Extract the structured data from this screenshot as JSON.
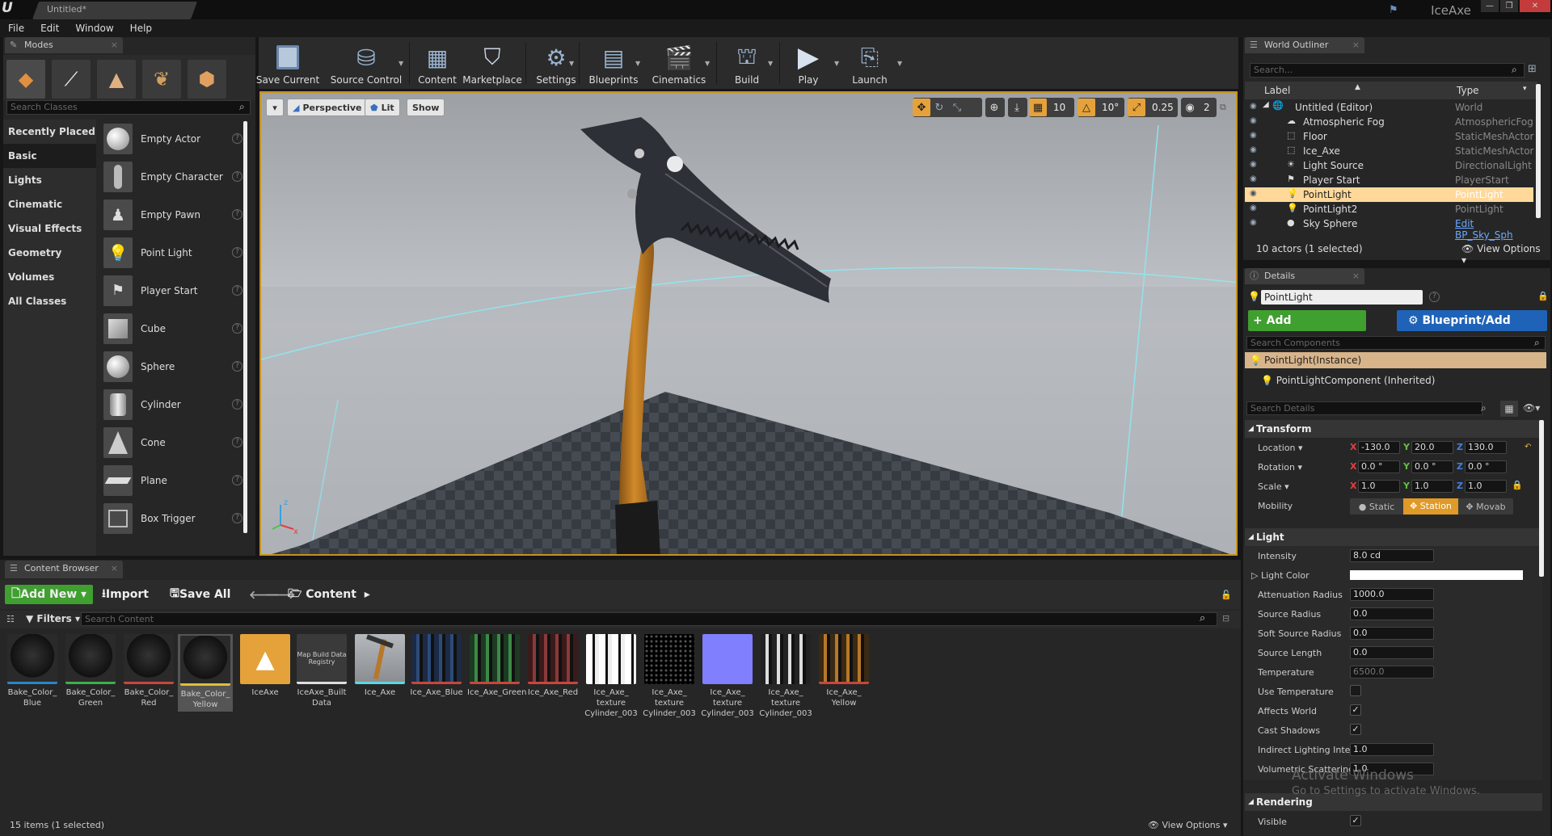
{
  "app": {
    "document_tab": "Untitled*",
    "project_name": "IceAxe"
  },
  "menu": [
    "File",
    "Edit",
    "Window",
    "Help"
  ],
  "modes": {
    "tab": "Modes",
    "search_placeholder": "Search Classes",
    "categories": [
      "Recently Placed",
      "Basic",
      "Lights",
      "Cinematic",
      "Visual Effects",
      "Geometry",
      "Volumes",
      "All Classes"
    ],
    "active_category": "Basic",
    "items": [
      "Empty Actor",
      "Empty Character",
      "Empty Pawn",
      "Point Light",
      "Player Start",
      "Cube",
      "Sphere",
      "Cylinder",
      "Cone",
      "Plane",
      "Box Trigger"
    ]
  },
  "toolbar": [
    "Save Current",
    "Source Control",
    "Content",
    "Marketplace",
    "Settings",
    "Blueprints",
    "Cinematics",
    "Build",
    "Play",
    "Launch"
  ],
  "viewport": {
    "perspective": "Perspective",
    "lit": "Lit",
    "show": "Show",
    "grid_snap": "10",
    "rot_snap": "10°",
    "scale_snap": "0.25",
    "camera_speed": "2"
  },
  "outliner": {
    "tab": "World Outliner",
    "search_placeholder": "Search...",
    "col_label": "Label",
    "col_type": "Type",
    "rows": [
      {
        "label": "Untitled (Editor)",
        "type": "World"
      },
      {
        "label": "Atmospheric Fog",
        "type": "AtmosphericFog"
      },
      {
        "label": "Floor",
        "type": "StaticMeshActor"
      },
      {
        "label": "Ice_Axe",
        "type": "StaticMeshActor"
      },
      {
        "label": "Light Source",
        "type": "DirectionalLight"
      },
      {
        "label": "Player Start",
        "type": "PlayerStart"
      },
      {
        "label": "PointLight",
        "type": "PointLight"
      },
      {
        "label": "PointLight2",
        "type": "PointLight"
      },
      {
        "label": "Sky Sphere",
        "type": "Edit BP_Sky_Sph"
      }
    ],
    "footer": "10 actors (1 selected)",
    "view_options": "View Options"
  },
  "details": {
    "tab": "Details",
    "name": "PointLight",
    "add_component": "+ Add Component",
    "blueprint": "Blueprint/Add Script",
    "search_components": "Search Components",
    "instance": "PointLight(Instance)",
    "component": "PointLightComponent (Inherited)",
    "search_details": "Search Details",
    "transform": "Transform",
    "location_label": "Location",
    "rotation_label": "Rotation",
    "scale_label": "Scale",
    "mobility_label": "Mobility",
    "location": [
      "-130.0",
      "20.0",
      "130.0"
    ],
    "rotation": [
      "0.0 °",
      "0.0 °",
      "0.0 °"
    ],
    "scale": [
      "1.0",
      "1.0",
      "1.0"
    ],
    "mobility": [
      "Static",
      "Station",
      "Movab"
    ],
    "light": "Light",
    "intensity_label": "Intensity",
    "intensity": "8.0 cd",
    "light_color_label": "Light Color",
    "atten_label": "Attenuation Radius",
    "atten": "1000.0",
    "source_radius_label": "Source Radius",
    "source_radius": "0.0",
    "soft_radius_label": "Soft Source Radius",
    "soft_radius": "0.0",
    "source_length_label": "Source Length",
    "source_length": "0.0",
    "temperature_label": "Temperature",
    "temperature": "6500.0",
    "use_temp_label": "Use Temperature",
    "affects_world_label": "Affects World",
    "cast_shadows_label": "Cast Shadows",
    "indirect_label": "Indirect Lighting Inten:",
    "indirect": "1.0",
    "volumetric_label": "Volumetric Scattering",
    "volumetric": "1.0",
    "rendering": "Rendering",
    "visible_label": "Visible"
  },
  "content_browser": {
    "tab": "Content Browser",
    "add_new": "Add New",
    "import": "Import",
    "save_all": "Save All",
    "path": "Content",
    "filters": "Filters",
    "search_placeholder": "Search Content",
    "assets": [
      "Bake_Color_ Blue",
      "Bake_Color_ Green",
      "Bake_Color_ Red",
      "Bake_Color_ Yellow",
      "IceAxe",
      "IceAxe_Built Data",
      "Ice_Axe",
      "Ice_Axe_Blue",
      "Ice_Axe_Green",
      "Ice_Axe_Red",
      "Ice_Axe_ texture Cylinder_003",
      "Ice_Axe_ texture Cylinder_003",
      "Ice_Axe_ texture Cylinder_003",
      "Ice_Axe_ texture Cylinder_003",
      "Ice_Axe_ Yellow"
    ],
    "map_build_thumb": "Map Build Data Registry",
    "footer": "15 items (1 selected)",
    "view_options": "View Options"
  },
  "watermark": {
    "line1": "Activate Windows",
    "line2": "Go to Settings to activate Windows."
  },
  "colors": {
    "accent": "#c8901e",
    "add_green": "#3f9f2f",
    "blue": "#1f63b8",
    "selection": "#ffd89a"
  }
}
